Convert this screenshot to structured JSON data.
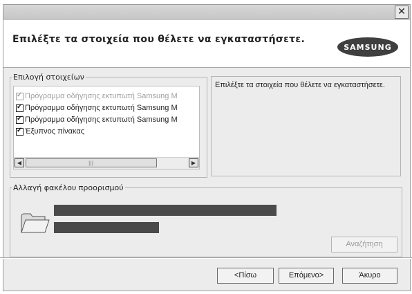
{
  "window": {
    "close_glyph": "✕"
  },
  "header": {
    "title": "Επιλέξτε τα στοιχεία που θέλετε να εγκαταστήσετε.",
    "brand": "SAMSUNG"
  },
  "components": {
    "legend": "Επιλογή στοιχείων",
    "items": [
      {
        "label": "Πρόγραμμα οδήγησης εκτυπωτή Samsung M",
        "checked": true,
        "disabled": true
      },
      {
        "label": "Πρόγραμμα οδήγησης εκτυπωτή Samsung M",
        "checked": true,
        "disabled": false
      },
      {
        "label": "Πρόγραμμα οδήγησης εκτυπωτή Samsung M",
        "checked": true,
        "disabled": false
      },
      {
        "label": "Έξυπνος πίνακας",
        "checked": true,
        "disabled": false
      }
    ],
    "description": "Επιλέξτε τα στοιχεία που θέλετε να εγκαταστήσετε."
  },
  "destination": {
    "legend": "Αλλαγή φακέλου προορισμού",
    "browse_label": "Αναζήτηση"
  },
  "footer": {
    "back_label": "<Πίσω",
    "next_label": "Επόμενο>",
    "cancel_label": "Άκυρο"
  }
}
